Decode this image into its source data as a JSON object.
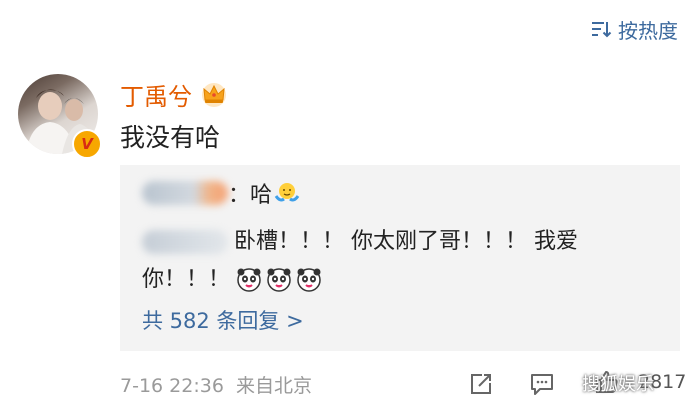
{
  "sort": {
    "label": "按热度",
    "icon": "sort-lines-icon"
  },
  "comment": {
    "username": "丁禹兮",
    "verified_badge": "V",
    "text": "我没有哈",
    "timestamp": "7-16 22:36",
    "source": "来自北京",
    "like_count": "2817"
  },
  "replies": [
    {
      "name": "",
      "separator": "：",
      "text": "哈",
      "emoji": "shrug-emoji"
    },
    {
      "name": "",
      "text_line1": "卧槽！！！ 你太刚了哥！！！ 我爱",
      "text_line2": "你！！！",
      "emoji": "panda-emoji"
    }
  ],
  "more_replies": "共 582 条回复 >",
  "watermark": "搜狐娱乐",
  "colors": {
    "username": "#e35b00",
    "link": "#3d6a9e",
    "reply_bg": "#f3f3f3",
    "meta": "#9a9a9a"
  }
}
